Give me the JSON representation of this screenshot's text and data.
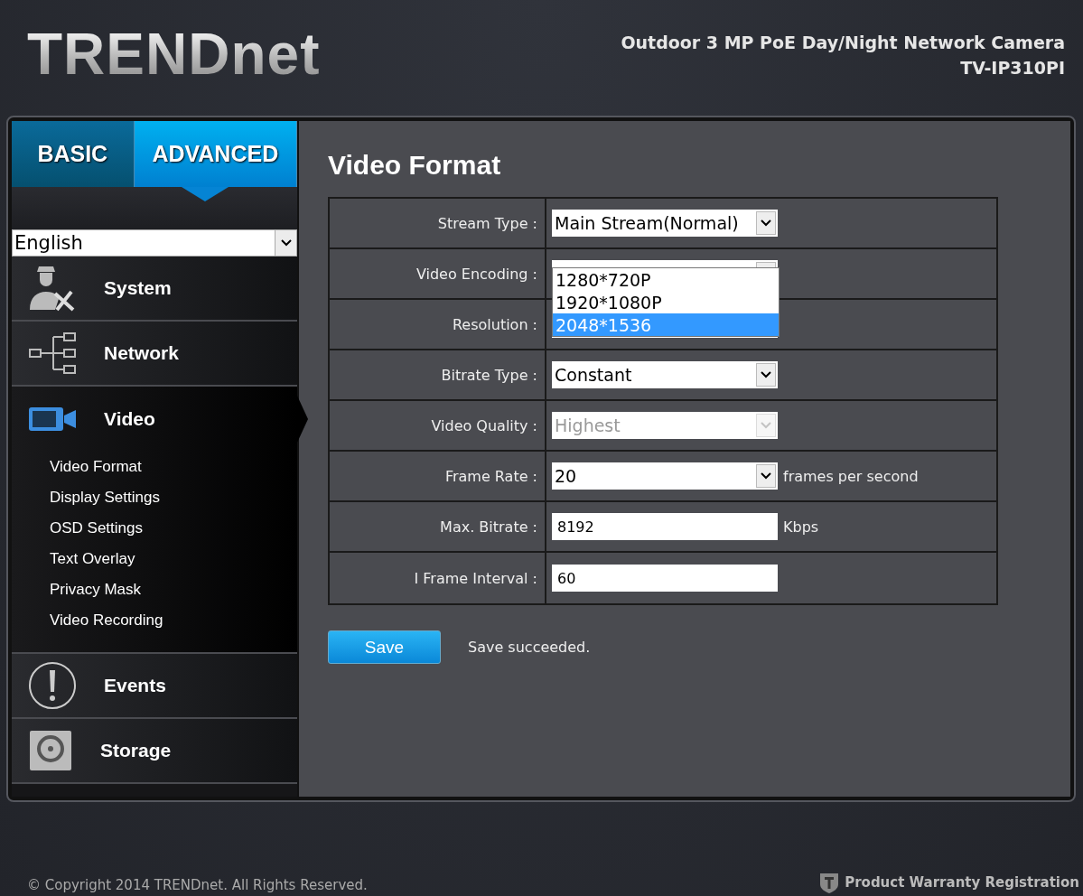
{
  "header": {
    "logo": "TRENDnet",
    "product": "Outdoor 3 MP PoE Day/Night Network Camera",
    "model": "TV-IP310PI"
  },
  "mode_tabs": [
    {
      "label": "BASIC",
      "selected": false
    },
    {
      "label": "ADVANCED",
      "selected": true
    }
  ],
  "language": {
    "value": "English"
  },
  "menu": [
    {
      "label": "System",
      "selected": false
    },
    {
      "label": "Network",
      "selected": false
    },
    {
      "label": "Video",
      "selected": true,
      "children": [
        {
          "label": "Video Format"
        },
        {
          "label": "Display Settings"
        },
        {
          "label": "OSD Settings"
        },
        {
          "label": "Text Overlay"
        },
        {
          "label": "Privacy Mask"
        },
        {
          "label": "Video Recording"
        }
      ]
    },
    {
      "label": "Events",
      "selected": false
    },
    {
      "label": "Storage",
      "selected": false
    }
  ],
  "page_title": "Video Format",
  "form": [
    {
      "label": "Stream Type :",
      "kind": "select",
      "value": "Main Stream(Normal)"
    },
    {
      "label": "Video Encoding :",
      "kind": "select",
      "open_list": [
        {
          "label": "1280*720P",
          "selected": false
        },
        {
          "label": "1920*1080P",
          "selected": false
        },
        {
          "label": "2048*1536",
          "selected": true
        }
      ]
    },
    {
      "label": "Resolution :",
      "kind": "select"
    },
    {
      "label": "Bitrate Type :",
      "kind": "select",
      "value": "Constant"
    },
    {
      "label": "Video Quality :",
      "kind": "select",
      "value": "Highest",
      "disabled": true
    },
    {
      "label": "Frame Rate :",
      "kind": "select",
      "value": "20",
      "unit": "frames per second"
    },
    {
      "label": "Max. Bitrate :",
      "kind": "input",
      "value": "8192",
      "unit": "Kbps"
    },
    {
      "label": "I Frame Interval :",
      "kind": "input",
      "value": "60"
    }
  ],
  "save_button": "Save",
  "save_status": "Save succeeded.",
  "footer": {
    "copyright": "© Copyright 2014 TRENDnet. All Rights Reserved.",
    "warranty": "Product Warranty Registration"
  }
}
